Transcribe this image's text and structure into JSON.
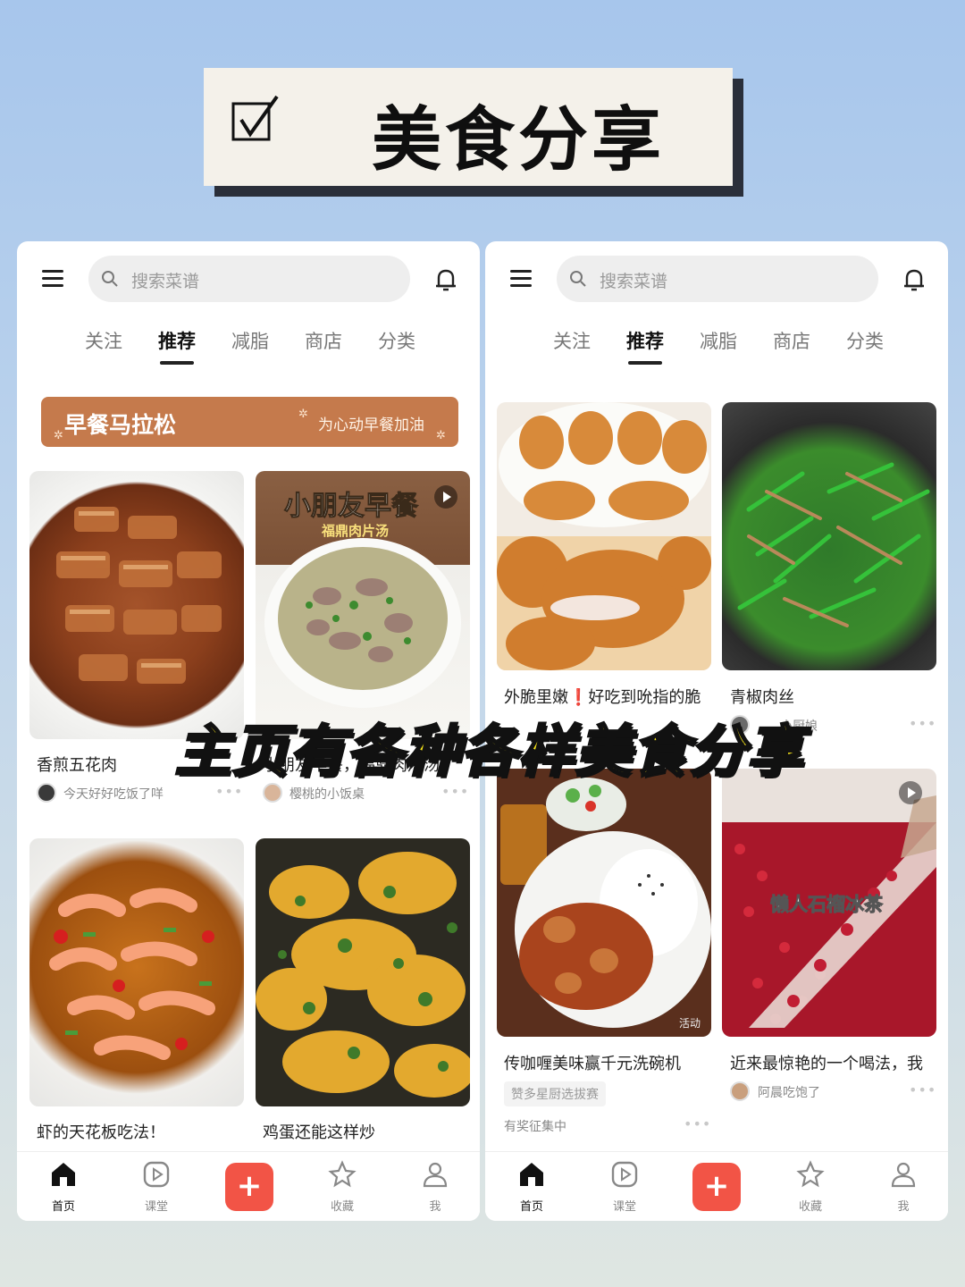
{
  "banner": {
    "title": "美食分享",
    "check_icon": "checkbox-checked-icon"
  },
  "caption": "主页有各种各样美食分享",
  "left_phone": {
    "search_placeholder": "搜索菜谱",
    "tabs": [
      "关注",
      "推荐",
      "减脂",
      "商店",
      "分类"
    ],
    "active_tab": "推荐",
    "promo": {
      "title": "早餐马拉松",
      "subtitle": "为心动早餐加油"
    },
    "cards": [
      {
        "title": "香煎五花肉",
        "author": "今天好好吃饭了咩",
        "more": "•••"
      },
      {
        "title": "小朋友早餐，福鼎肉片汤",
        "author": "樱桃的小饭桌",
        "more": "•••",
        "image_title": "小朋友早餐",
        "image_subtitle": "福鼎肉片汤"
      },
      {
        "title": "虾的天花板吃法！",
        "author": "",
        "more": ""
      },
      {
        "title": "鸡蛋还能这样炒",
        "author": "",
        "more": ""
      }
    ],
    "nav": [
      "首页",
      "课堂",
      "+",
      "收藏",
      "我"
    ]
  },
  "right_phone": {
    "search_placeholder": "搜索菜谱",
    "tabs": [
      "关注",
      "推荐",
      "减脂",
      "商店",
      "分类"
    ],
    "active_tab": "推荐",
    "cards": [
      {
        "title": "外脆里嫩❗️好吃到吮指的脆",
        "author": "",
        "more": ""
      },
      {
        "title": "青椒肉丝",
        "author": "小厨娘",
        "more": "•••"
      },
      {
        "title": "传咖喱美味赢千元洗碗机",
        "tag": "赞多星厨选拔赛",
        "author": "有奖征集中",
        "more": "•••",
        "image_badge": "活动"
      },
      {
        "title": "近来最惊艳的一个喝法，我",
        "author": "阿晨吃饱了",
        "more": "•••",
        "image_title": "懒人石榴冰茶"
      }
    ],
    "nav": [
      "首页",
      "课堂",
      "+",
      "收藏",
      "我"
    ]
  }
}
